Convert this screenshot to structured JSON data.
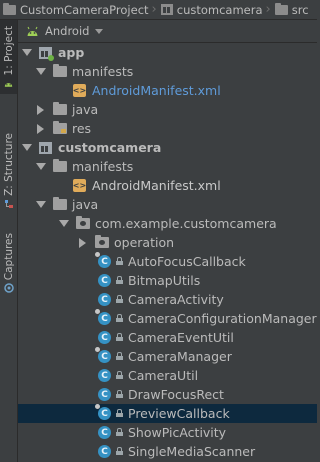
{
  "breadcrumb": {
    "items": [
      {
        "label": "CustomCameraProject",
        "icon": "folder-icon"
      },
      {
        "label": "customcamera",
        "icon": "module-icon"
      },
      {
        "label": "src",
        "icon": "folder-icon"
      }
    ]
  },
  "sidebar": {
    "tabs": [
      {
        "label": "1: Project",
        "icon": "android-icon"
      },
      {
        "label": "Z: Structure",
        "icon": "structure-icon"
      },
      {
        "label": "Captures",
        "icon": "captures-icon"
      }
    ]
  },
  "view_selector": {
    "label": "Android",
    "icon": "android-icon"
  },
  "tree": {
    "app": "app",
    "app_manifests": "manifests",
    "app_manifest_file": "AndroidManifest.xml",
    "app_java": "java",
    "app_res": "res",
    "module": "customcamera",
    "module_manifests": "manifests",
    "module_manifest_file": "AndroidManifest.xml",
    "module_java": "java",
    "package": "com.example.customcamera",
    "operation": "operation",
    "classes": [
      "AutoFocusCallback",
      "BitmapUtils",
      "CameraActivity",
      "CameraConfigurationManager",
      "CameraEventUtil",
      "CameraManager",
      "CameraUtil",
      "DrawFocusRect",
      "PreviewCallback",
      "ShowPicActivity",
      "SingleMediaScanner"
    ],
    "class_icon_letter": "C",
    "selected_class": "PreviewCallback"
  },
  "colors": {
    "background": "#3c3f41",
    "selection": "#0d293e",
    "class_icon": "#3592c4",
    "manifest_link": "#5f9bd9"
  }
}
